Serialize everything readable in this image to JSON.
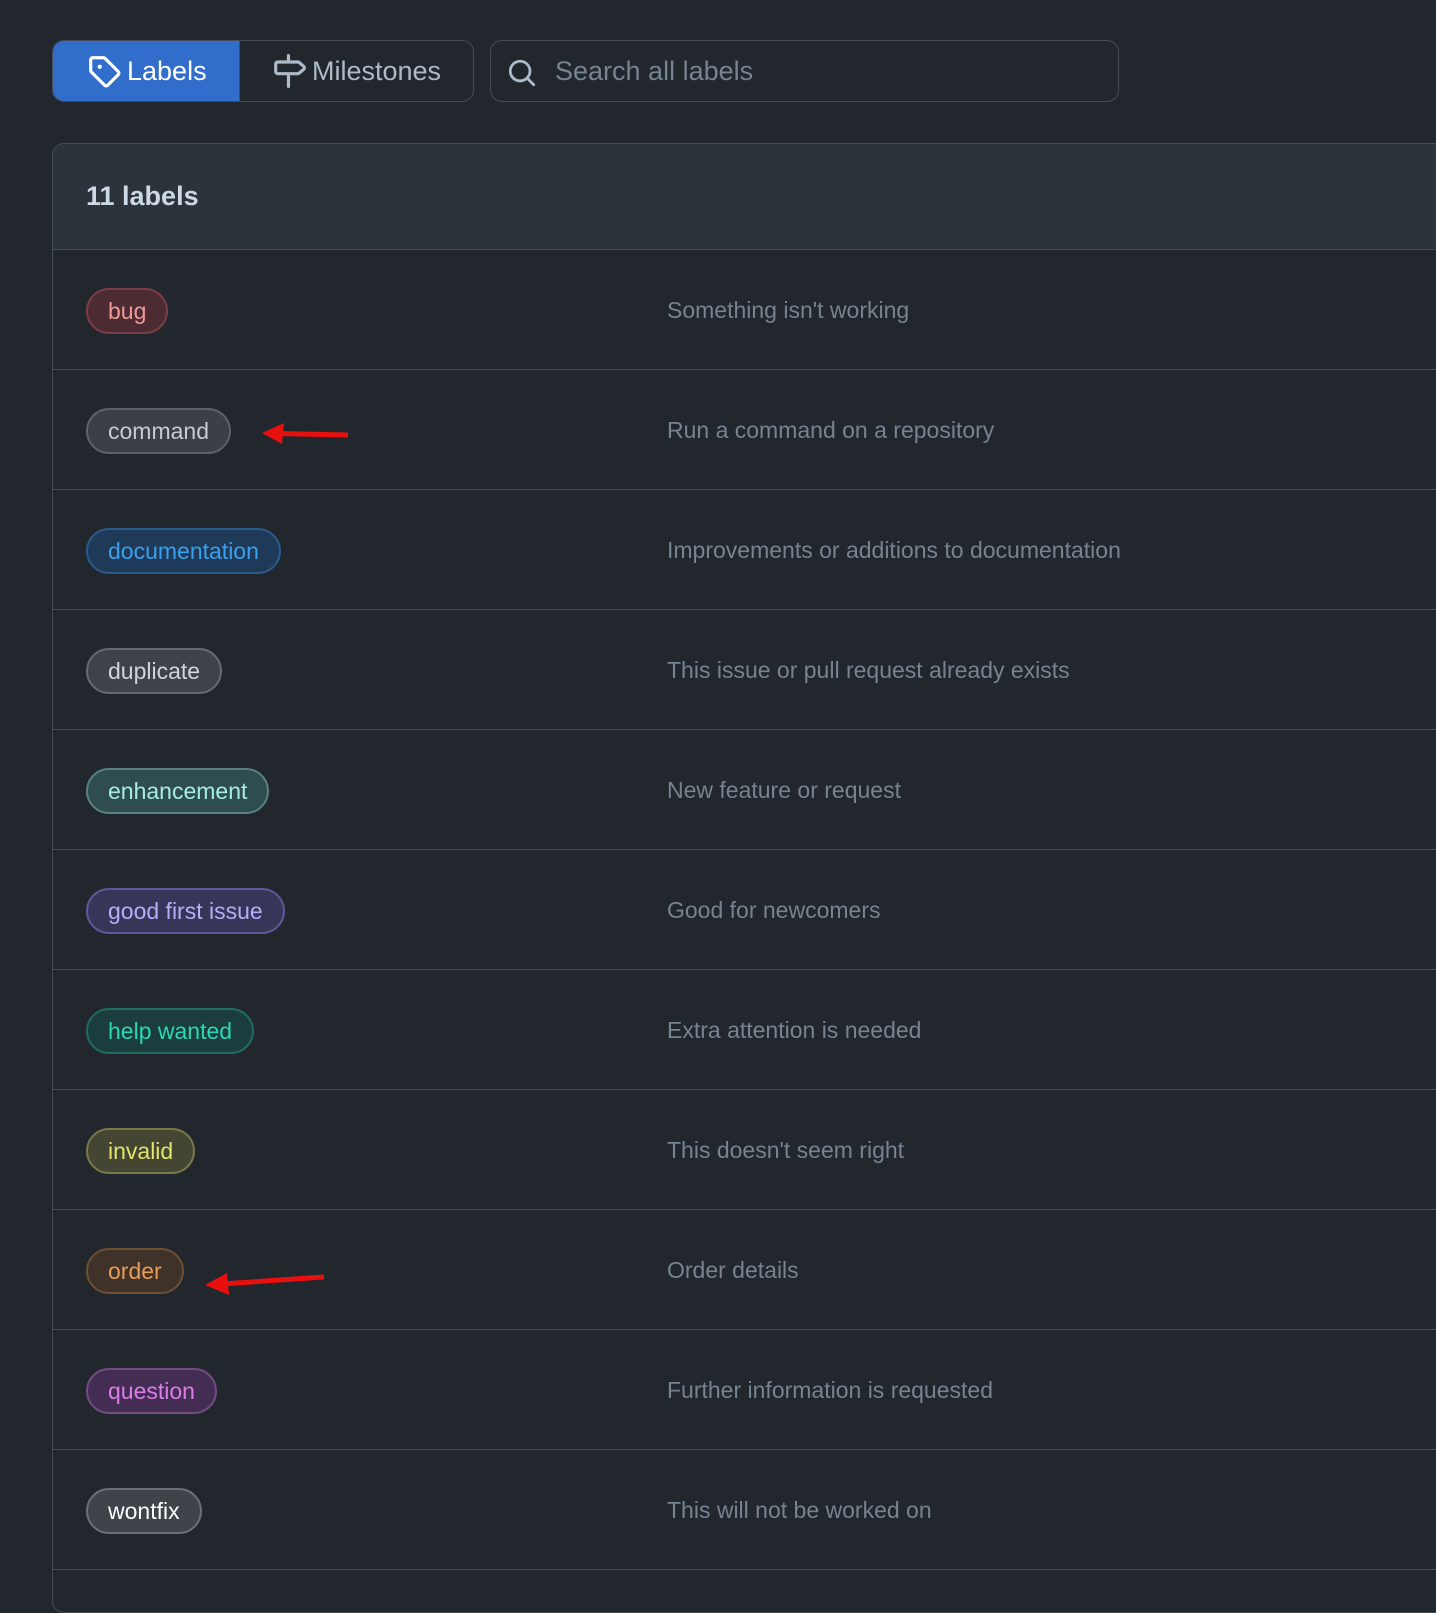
{
  "subnav": {
    "labels_label": "Labels",
    "milestones_label": "Milestones",
    "labels_icon": "tag-icon",
    "milestones_icon": "milestone-icon"
  },
  "search": {
    "placeholder": "Search all labels",
    "value": "",
    "icon": "search-icon"
  },
  "header": {
    "count_text": "11 labels"
  },
  "labels": [
    {
      "name": "bug",
      "description": "Something isn't working",
      "text_color": "#f19999",
      "bg_color": "#4d2b33",
      "border_color": "#7a3e48"
    },
    {
      "name": "command",
      "description": "Run a command on a repository",
      "text_color": "#c5ccd6",
      "bg_color": "#3a3f48",
      "border_color": "#5b626c"
    },
    {
      "name": "documentation",
      "description": "Improvements or additions to documentation",
      "text_color": "#39a0ed",
      "bg_color": "#1f3a58",
      "border_color": "#2b5a89"
    },
    {
      "name": "duplicate",
      "description": "This issue or pull request already exists",
      "text_color": "#d1d5da",
      "bg_color": "#3e434b",
      "border_color": "#646a73"
    },
    {
      "name": "enhancement",
      "description": "New feature or request",
      "text_color": "#a6ece6",
      "bg_color": "#2f4c4f",
      "border_color": "#57817f"
    },
    {
      "name": "good first issue",
      "description": "Good for newcomers",
      "text_color": "#b6aef8",
      "bg_color": "#363659",
      "border_color": "#5a5a9a"
    },
    {
      "name": "help wanted",
      "description": "Extra attention is needed",
      "text_color": "#2bd7b4",
      "bg_color": "#1c3d3d",
      "border_color": "#1f6c5e"
    },
    {
      "name": "invalid",
      "description": "This doesn't seem right",
      "text_color": "#e2e36b",
      "bg_color": "#444532",
      "border_color": "#77784a"
    },
    {
      "name": "order",
      "description": "Order details",
      "text_color": "#e79b56",
      "bg_color": "#3f3229",
      "border_color": "#6c4f35"
    },
    {
      "name": "question",
      "description": "Further information is requested",
      "text_color": "#dc7ce9",
      "bg_color": "#442d53",
      "border_color": "#734c84"
    },
    {
      "name": "wontfix",
      "description": "This will not be worked on",
      "text_color": "#ffffff",
      "bg_color": "#3f444b",
      "border_color": "#6b7078"
    }
  ],
  "annotations": {
    "arrow_color": "#e8100e",
    "arrow_icon": "red-arrow-annotation"
  }
}
